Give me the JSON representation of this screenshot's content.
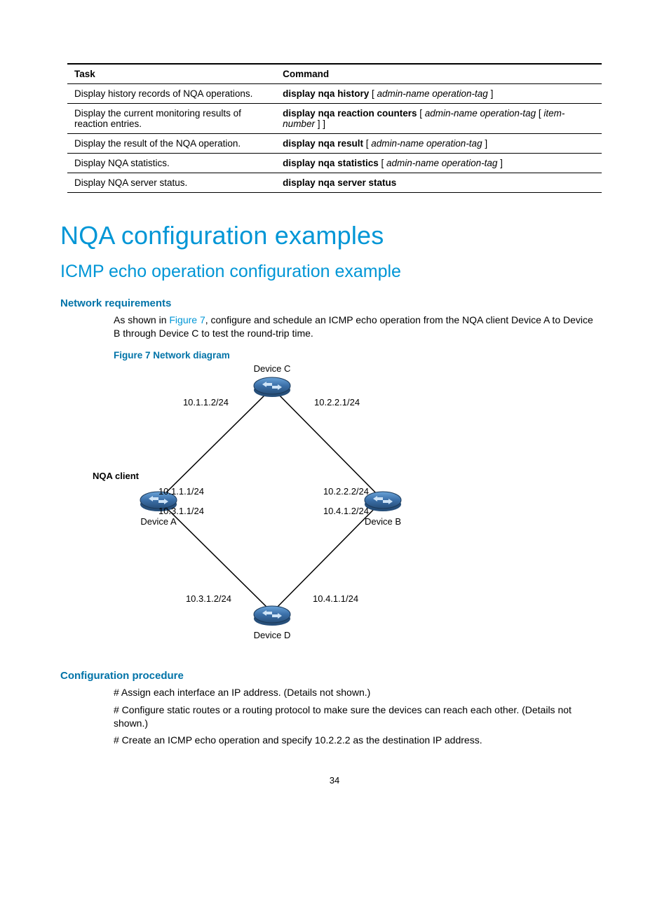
{
  "table": {
    "headers": {
      "task": "Task",
      "command": "Command"
    },
    "rows": [
      {
        "task": "Display history records of NQA operations.",
        "cmd_bold": "display nqa history",
        "cmd_ital": "admin-name operation-tag",
        "has_outer": false
      },
      {
        "task": "Display the current monitoring results of reaction entries.",
        "cmd_bold": "display nqa reaction counters",
        "cmd_ital": "admin-name operation-tag",
        "inner_ital": "item-number",
        "has_outer": true
      },
      {
        "task": "Display the result of the NQA operation.",
        "cmd_bold": "display nqa result",
        "cmd_ital": "admin-name operation-tag",
        "has_outer": false
      },
      {
        "task": "Display NQA statistics.",
        "cmd_bold": "display nqa statistics",
        "cmd_ital": "admin-name operation-tag",
        "has_outer": false
      },
      {
        "task": "Display NQA server status.",
        "cmd_bold": "display nqa server status",
        "cmd_ital": "",
        "has_outer": false,
        "no_brackets": true
      }
    ]
  },
  "headings": {
    "main": "NQA configuration examples",
    "sub": "ICMP echo operation configuration example",
    "netreq": "Network requirements",
    "confproc": "Configuration procedure"
  },
  "body": {
    "netreq_p1_a": "As shown in ",
    "netreq_p1_link": "Figure 7",
    "netreq_p1_b": ", configure and schedule an ICMP echo operation from the NQA client Device A to Device B through Device C to test the round-trip time.",
    "fig_caption": "Figure 7 Network diagram",
    "proc1": "# Assign each interface an IP address. (Details not shown.)",
    "proc2": "# Configure static routes or a routing protocol to make sure the devices can reach each other. (Details not shown.)",
    "proc3": "# Create an ICMP echo operation and specify 10.2.2.2 as the destination IP address."
  },
  "diagram": {
    "nqa_client": "NQA client",
    "dev_a": "Device A",
    "dev_b": "Device B",
    "dev_c": "Device C",
    "dev_d": "Device D",
    "ip_c_left": "10.1.1.2/24",
    "ip_c_right": "10.2.2.1/24",
    "ip_a_top": "10.1.1.1/24",
    "ip_a_bot": "10.3.1.1/24",
    "ip_b_top": "10.2.2.2/24",
    "ip_b_bot": "10.4.1.2/24",
    "ip_d_left": "10.3.1.2/24",
    "ip_d_right": "10.4.1.1/24"
  },
  "pagenum": "34"
}
